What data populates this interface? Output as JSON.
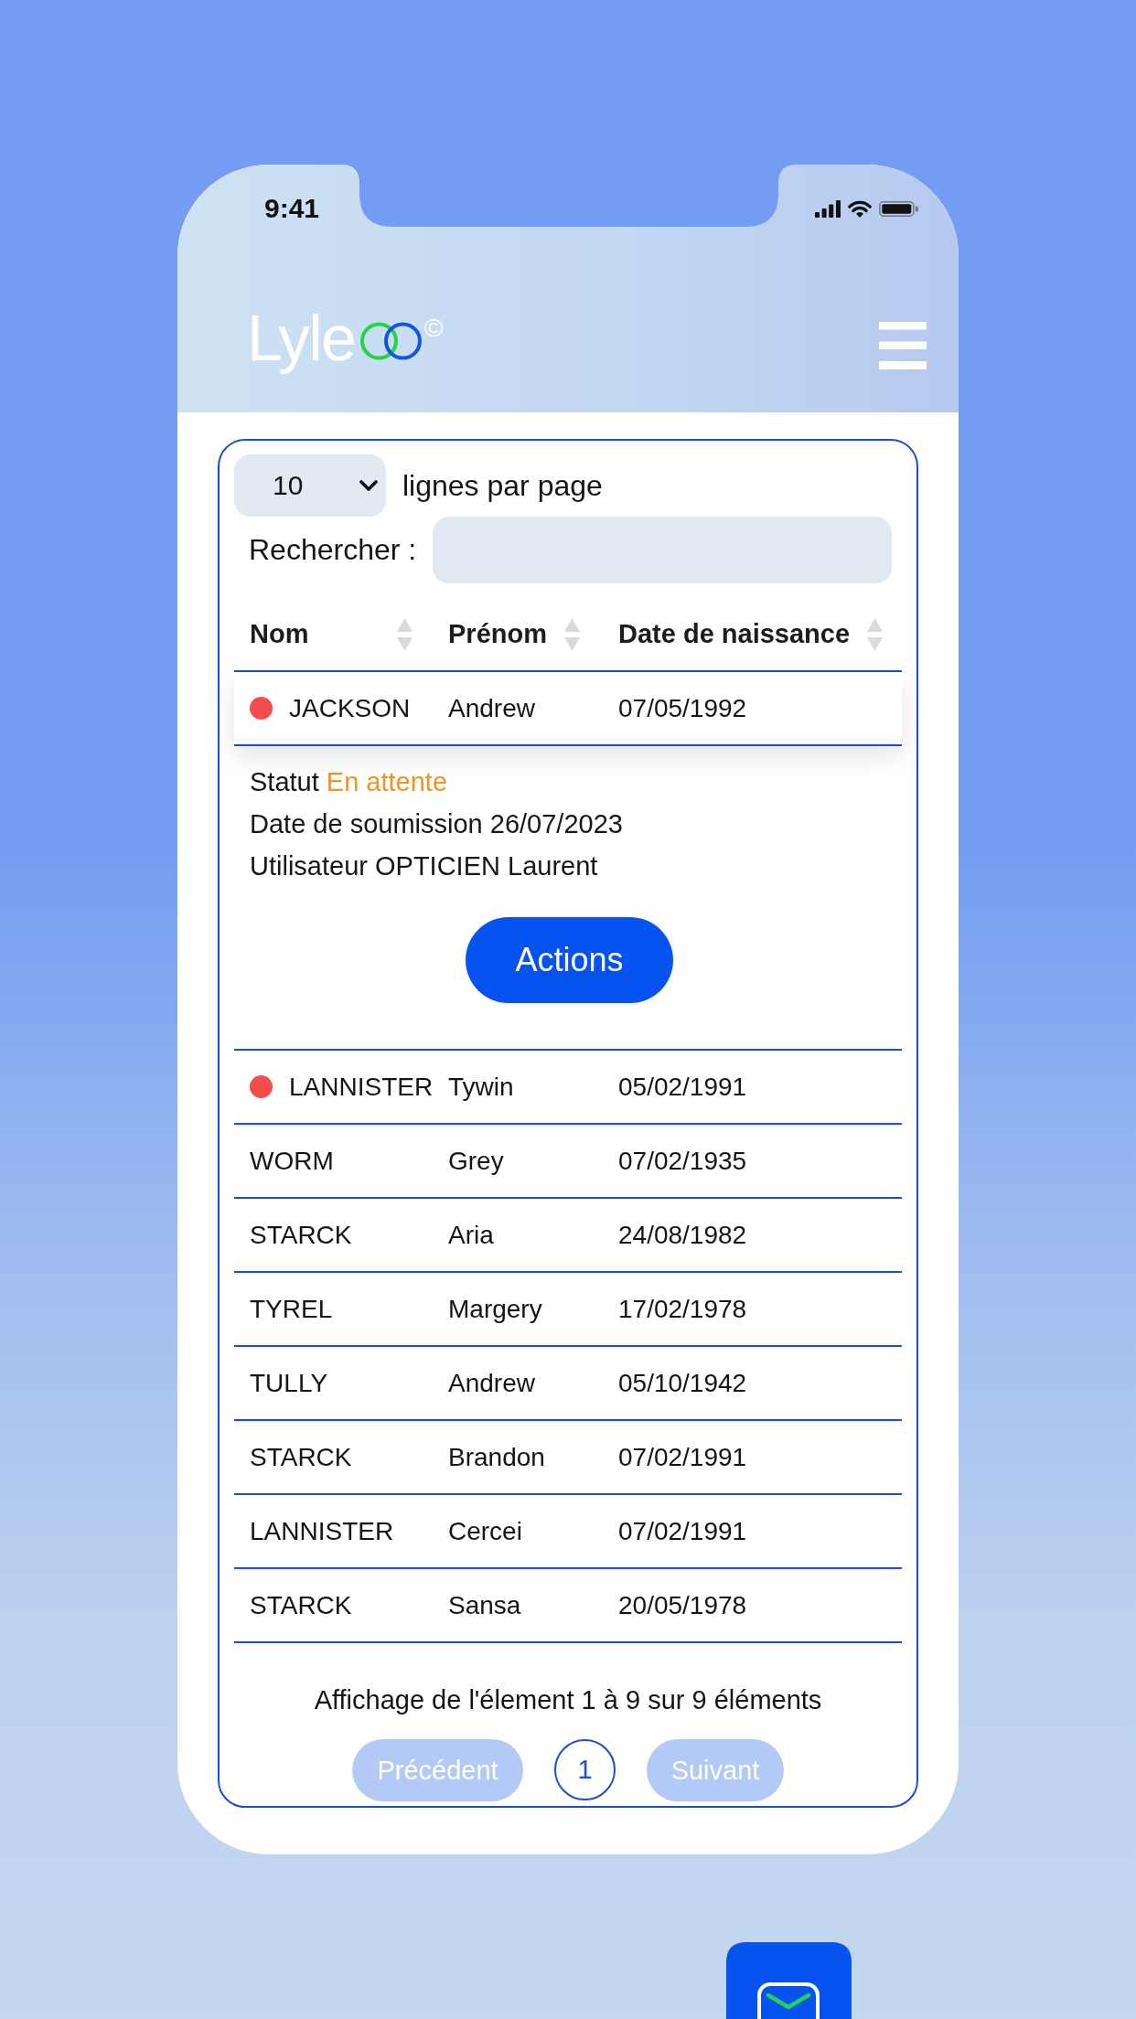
{
  "status_bar": {
    "time": "9:41"
  },
  "header": {
    "logo_text": "Lyle",
    "logo_mark": "©"
  },
  "controls": {
    "page_size": "10",
    "page_size_label": "lignes par page",
    "search_label": "Rechercher :"
  },
  "table": {
    "columns": [
      {
        "label": "Nom"
      },
      {
        "label": "Prénom"
      },
      {
        "label": "Date de naissance"
      }
    ],
    "rows": [
      {
        "cells": [
          "JACKSON",
          "Andrew",
          "07/05/1992"
        ],
        "flagged": true,
        "expanded": true,
        "details": {
          "lines": [
            {
              "label": "Statut",
              "value": "En attente",
              "kind": "status"
            },
            {
              "label": "Date de soumission",
              "value": "26/07/2023",
              "kind": "plain"
            },
            {
              "label": "Utilisateur",
              "value": "OPTICIEN Laurent",
              "kind": "plain"
            }
          ],
          "action": "Actions"
        }
      },
      {
        "cells": [
          "LANNISTER",
          "Tywin",
          "05/02/1991"
        ],
        "flagged": true,
        "expanded": false
      },
      {
        "cells": [
          "WORM",
          "Grey",
          "07/02/1935"
        ],
        "flagged": false,
        "expanded": false
      },
      {
        "cells": [
          "STARCK",
          "Aria",
          "24/08/1982"
        ],
        "flagged": false,
        "expanded": false
      },
      {
        "cells": [
          "TYREL",
          "Margery",
          "17/02/1978"
        ],
        "flagged": false,
        "expanded": false
      },
      {
        "cells": [
          "TULLY",
          "Andrew",
          "05/10/1942"
        ],
        "flagged": false,
        "expanded": false
      },
      {
        "cells": [
          "STARCK",
          "Brandon",
          "07/02/1991"
        ],
        "flagged": false,
        "expanded": false
      },
      {
        "cells": [
          "LANNISTER",
          "Cercei",
          "07/02/1991"
        ],
        "flagged": false,
        "expanded": false
      },
      {
        "cells": [
          "STARCK",
          "Sansa",
          "20/05/1978"
        ],
        "flagged": false,
        "expanded": false
      }
    ]
  },
  "pagination": {
    "info": "Affichage de l'élement 1 à 9 sur 9 éléments",
    "previous": {
      "label": "Précédent",
      "disabled": true
    },
    "pages": [
      {
        "label": "1",
        "selected": true
      }
    ],
    "next": {
      "label": "Suivant",
      "disabled": true
    }
  }
}
